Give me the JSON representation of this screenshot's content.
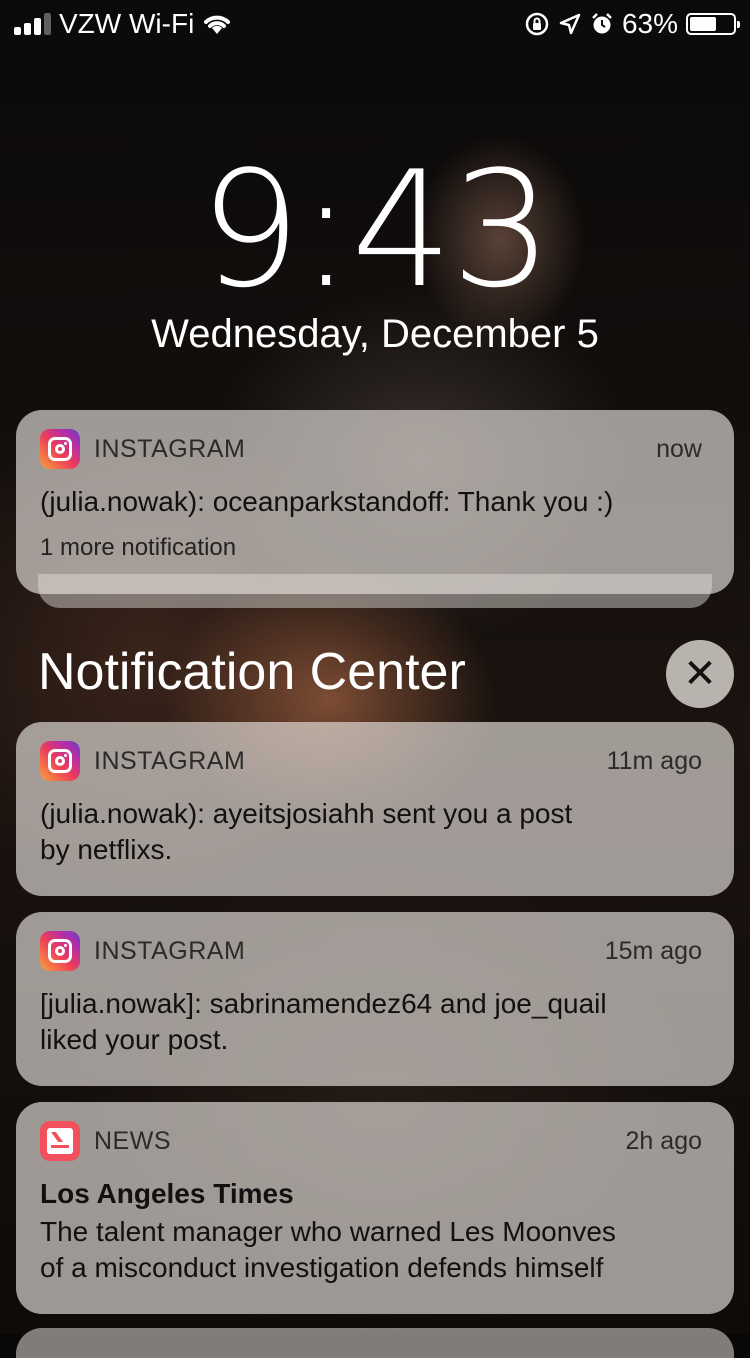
{
  "status_bar": {
    "carrier": "VZW Wi-Fi",
    "signal_bars_filled": 3,
    "signal_bars_total": 4,
    "wifi_icon": "wifi-icon",
    "orientation_lock_icon": "orientation-lock-icon",
    "location_icon": "location-arrow-icon",
    "alarm_icon": "alarm-clock-icon",
    "battery_percent": "63%",
    "battery_level": 0.63
  },
  "lock_screen": {
    "time": "9:43",
    "date": "Wednesday, December 5"
  },
  "pinned_notification": {
    "app_name": "INSTAGRAM",
    "time": "now",
    "body": "(julia.nowak): oceanparkstandoff: Thank you :)",
    "more": "1 more notification"
  },
  "notification_center": {
    "title": "Notification Center",
    "clear_symbol": "✕"
  },
  "notifications": [
    {
      "app_name": "INSTAGRAM",
      "time": "11m ago",
      "body_line1": "(julia.nowak): ayeitsjosiahh sent you a post",
      "body_line2": "by netflixs."
    },
    {
      "app_name": "INSTAGRAM",
      "time": "15m ago",
      "body_line1": "[julia.nowak]: sabrinamendez64 and joe_quail",
      "body_line2": "liked your post."
    },
    {
      "app_name": "NEWS",
      "time": "2h ago",
      "title": "Los Angeles Times",
      "body_line1": "The talent manager who warned Les Moonves",
      "body_line2": "of a misconduct investigation defends himself"
    }
  ],
  "colors": {
    "instagram_gradient_start": "#f9a33a",
    "instagram_gradient_end": "#6a3cc9",
    "news_red": "#f2505c",
    "card_background": "#e1dcd7"
  }
}
